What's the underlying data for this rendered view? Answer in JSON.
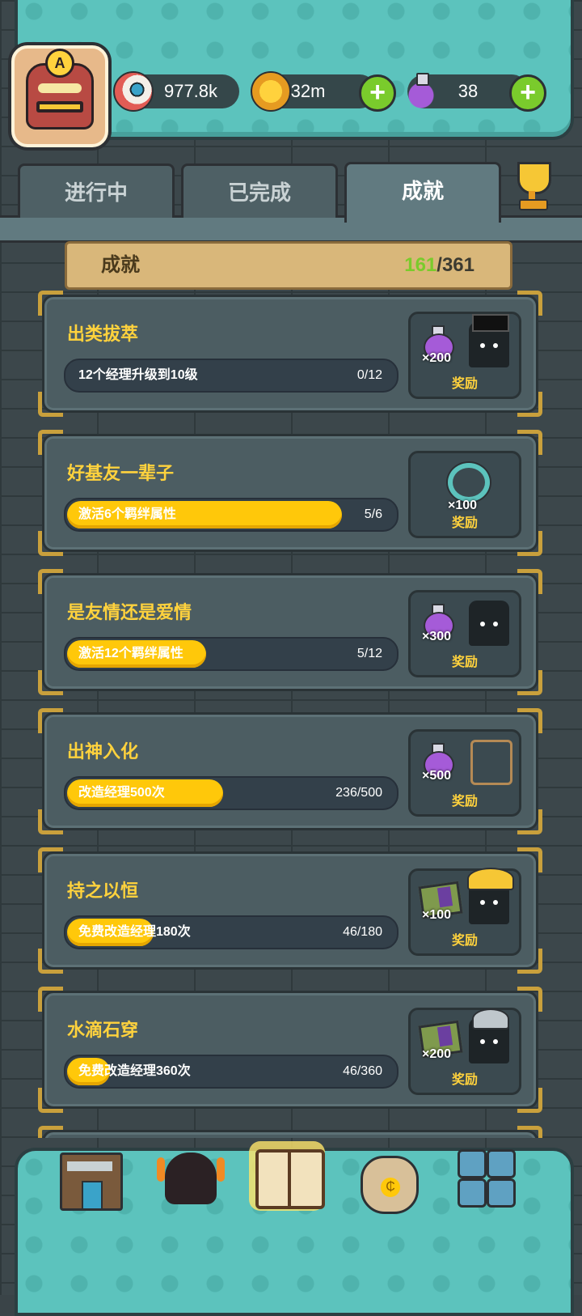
{
  "resources": {
    "eyes": "977.8k",
    "coins": "32m",
    "potions": "38"
  },
  "avatar": {
    "badge": "A"
  },
  "tabs": [
    {
      "label": "进行中",
      "active": false
    },
    {
      "label": "已完成",
      "active": false
    },
    {
      "label": "成就",
      "active": true
    }
  ],
  "achievements_header": {
    "title": "成就",
    "done": "161",
    "total_text": "/361"
  },
  "achievements": [
    {
      "name": "出类拔萃",
      "desc": "12个经理升级到10级",
      "progress": "0/12",
      "fill": 0.0,
      "reward_qty": "×200",
      "reward_label": "奖励"
    },
    {
      "name": "好基友一辈子",
      "desc": "激活6个羁绊属性",
      "progress": "5/6",
      "fill": 0.83,
      "reward_qty": "×100",
      "reward_label": "奖励"
    },
    {
      "name": "是友情还是爱情",
      "desc": "激活12个羁绊属性",
      "progress": "5/12",
      "fill": 0.42,
      "reward_qty": "×300",
      "reward_label": "奖励"
    },
    {
      "name": "出神入化",
      "desc": "改造经理500次",
      "progress": "236/500",
      "fill": 0.47,
      "reward_qty": "×500",
      "reward_label": "奖励"
    },
    {
      "name": "持之以恒",
      "desc": "免费改造经理180次",
      "progress": "46/180",
      "fill": 0.26,
      "reward_qty": "×100",
      "reward_label": "奖励"
    },
    {
      "name": "水滴石穿",
      "desc": "免费改造经理360次",
      "progress": "46/360",
      "fill": 0.13,
      "reward_qty": "×200",
      "reward_label": "奖励"
    }
  ],
  "colors": {
    "accent_yellow": "#ffd23d",
    "progress_fill": "#ffc80a",
    "done_count": "#7acb2c",
    "teal": "#5cc3bd"
  }
}
